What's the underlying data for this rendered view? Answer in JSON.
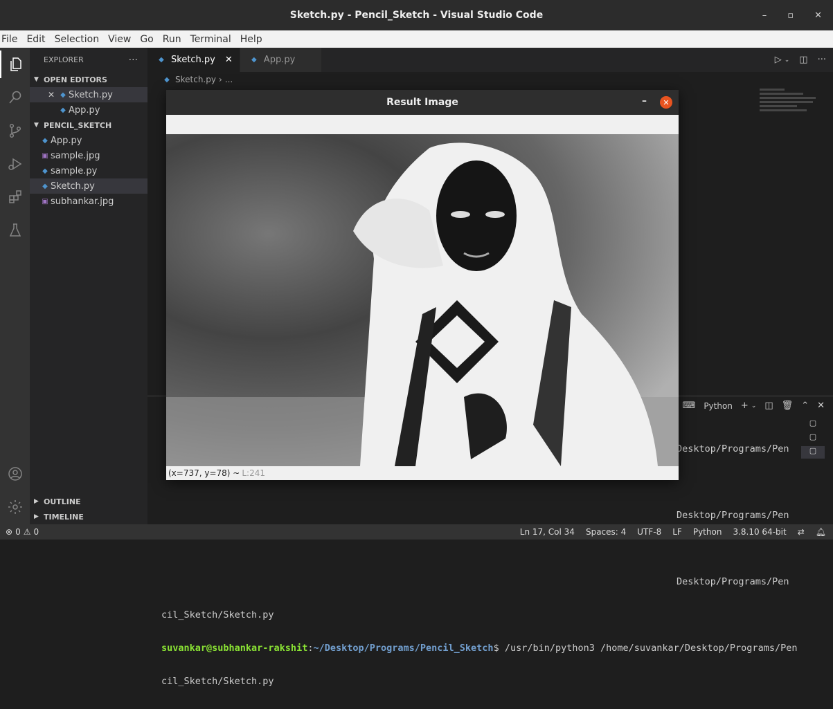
{
  "window": {
    "title": "Sketch.py - Pencil_Sketch - Visual Studio Code",
    "min": "–",
    "max": "▫",
    "close": "✕"
  },
  "menu": [
    "File",
    "Edit",
    "Selection",
    "View",
    "Go",
    "Run",
    "Terminal",
    "Help"
  ],
  "sidebar": {
    "title": "EXPLORER",
    "more": "···",
    "open_editors_label": "OPEN EDITORS",
    "open_editors": [
      {
        "label": "Sketch.py"
      },
      {
        "label": "App.py"
      }
    ],
    "project_label": "PENCIL_SKETCH",
    "files": [
      {
        "label": "App.py",
        "kind": "py"
      },
      {
        "label": "sample.jpg",
        "kind": "jpg"
      },
      {
        "label": "sample.py",
        "kind": "py"
      },
      {
        "label": "Sketch.py",
        "kind": "py"
      },
      {
        "label": "subhankar.jpg",
        "kind": "jpg"
      }
    ],
    "outline_label": "OUTLINE",
    "timeline_label": "TIMELINE"
  },
  "tabs": [
    {
      "label": "Sketch.py"
    },
    {
      "label": "App.py"
    }
  ],
  "breadcrumb": {
    "file": "Sketch.py",
    "sep": "›",
    "more": "..."
  },
  "panel": {
    "shell": "Python",
    "terms": [
      "▢",
      "▢",
      "▢"
    ]
  },
  "terminal": {
    "lines_right": [
      "Desktop/Programs/Pen",
      "Desktop/Programs/Pen",
      "Desktop/Programs/Pen"
    ],
    "line_cont": "cil_Sketch/Sketch.py",
    "prompt_user": "suvankar@subhankar-rakshit",
    "prompt_colon": ":",
    "prompt_path": "~/Desktop/Programs/Pencil_Sketch",
    "prompt_cmd": "$ /usr/bin/python3 /home/suvankar/Desktop/Programs/Pen",
    "last_line": "cil_Sketch/Sketch.py"
  },
  "popup": {
    "title": "Result Image",
    "min": "–",
    "close": "✕",
    "coords": "(x=737, y=78) ~",
    "level": "L:241"
  },
  "status": {
    "errors": "0",
    "warnings": "0",
    "position": "Ln 17, Col 34",
    "spaces": "Spaces: 4",
    "encoding": "UTF-8",
    "eol": "LF",
    "language": "Python",
    "interpreter": "3.8.10 64-bit"
  }
}
